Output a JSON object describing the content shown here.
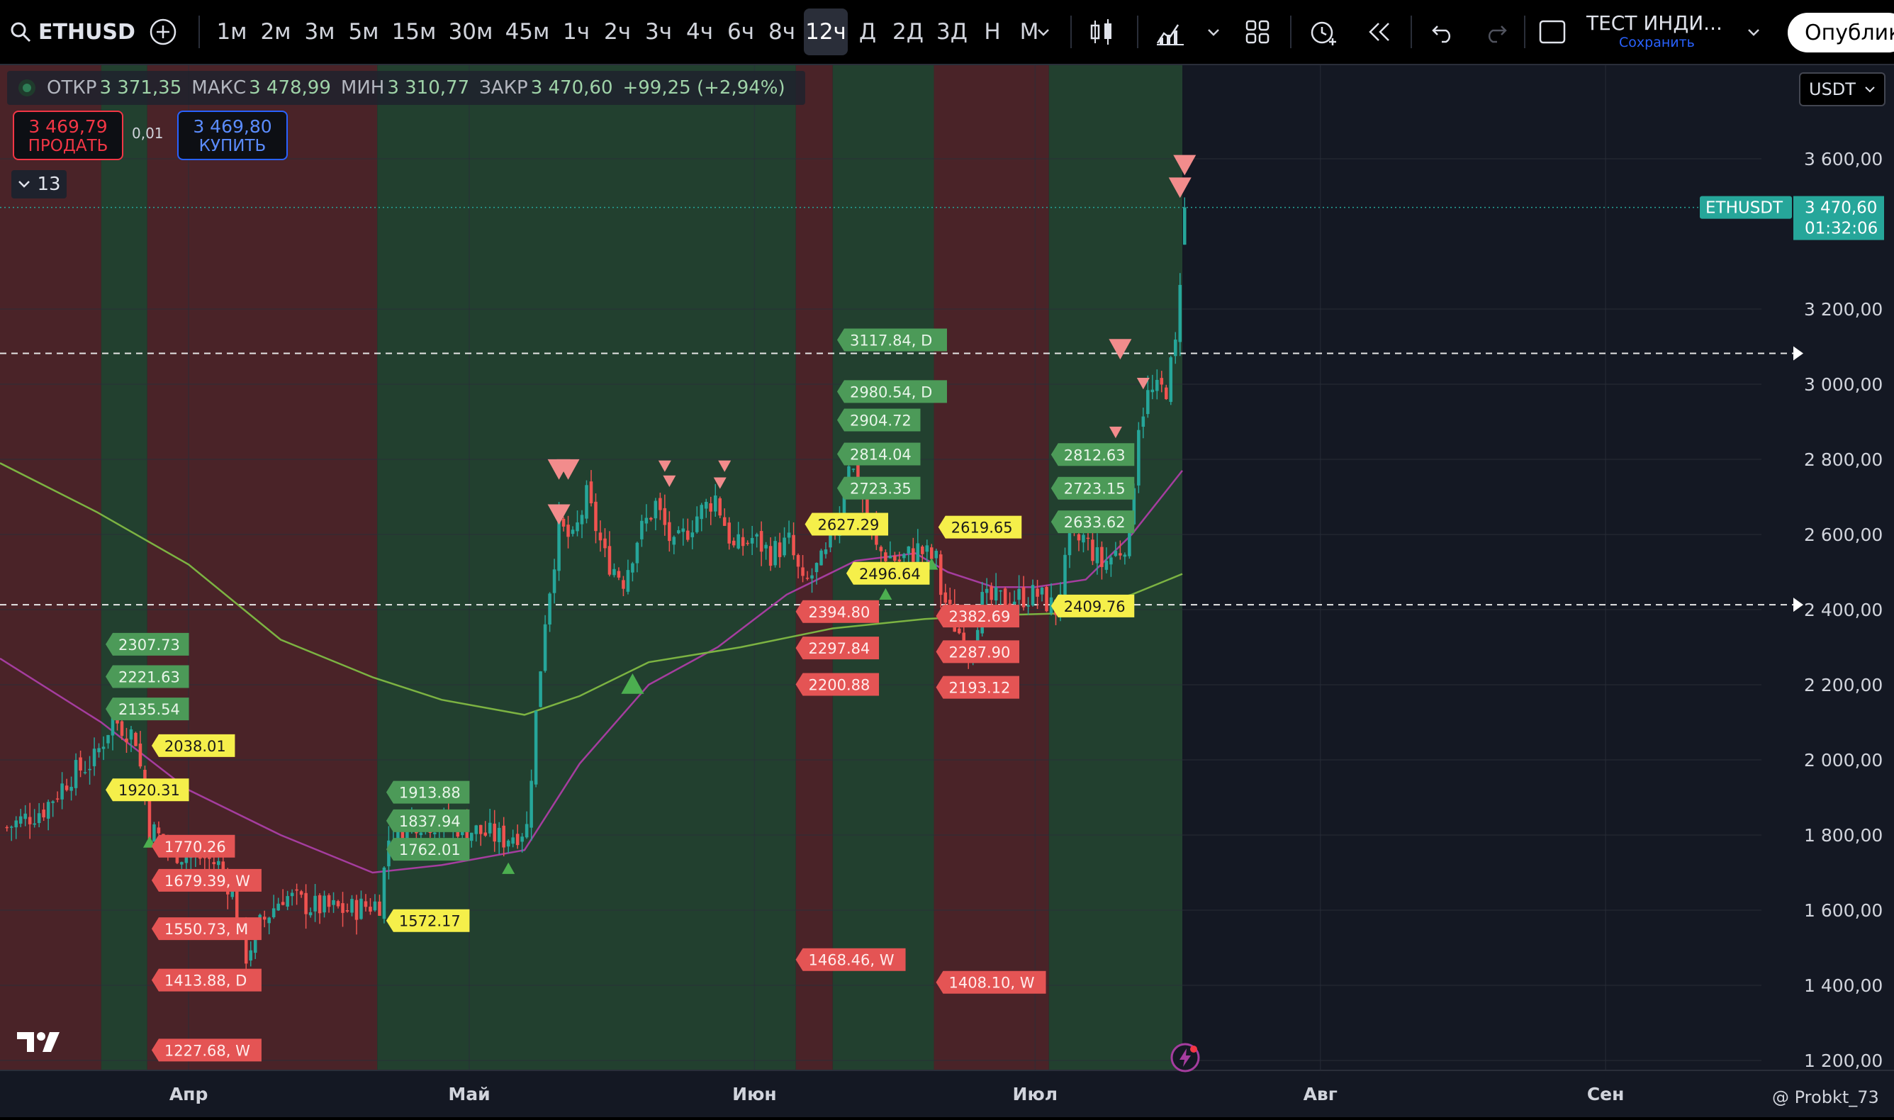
{
  "toolbar": {
    "symbol": "ETHUSD",
    "timeframes": [
      "1м",
      "2м",
      "3м",
      "5м",
      "15м",
      "30м",
      "45м",
      "1ч",
      "2ч",
      "3ч",
      "4ч",
      "6ч",
      "8ч",
      "12ч",
      "Д",
      "2Д",
      "3Д",
      "Н",
      "М"
    ],
    "active_timeframe": "12ч",
    "indicator_title": "ТЕСТ ИНДИ...",
    "save_label": "Сохранить",
    "publish_label": "Опублико"
  },
  "legend": {
    "open_label": "ОТКР",
    "open": "3 371,35",
    "high_label": "МАКС",
    "high": "3 478,99",
    "low_label": "МИН",
    "low": "3 310,77",
    "close_label": "ЗАКР",
    "close": "3 470,60",
    "change": "+99,25 (+2,94%)"
  },
  "trade": {
    "sell_price": "3 469,79",
    "sell_label": "ПРОДАТЬ",
    "spread": "0,01",
    "buy_price": "3 469,80",
    "buy_label": "КУПИТЬ",
    "counter": "13"
  },
  "currency": "USDT",
  "price_tag": {
    "symbol": "ETHUSDT",
    "price": "3 470,60",
    "countdown": "01:32:06"
  },
  "watermark": "@ Probkt_73",
  "colors": {
    "up": "#26a69a",
    "down": "#ef5350",
    "zone_red": "#4a2328",
    "zone_green": "#22402f",
    "sma_short": "#a53d9f",
    "sma_long": "#7cb342",
    "label_green": "#4c9a58",
    "label_red": "#e45454",
    "label_yellow": "#f5ef4a"
  },
  "chart_data": {
    "type": "candlestick",
    "ylim": [
      1150,
      3800
    ],
    "y_ticks": [
      {
        "v": 3600,
        "t": "3 600,00"
      },
      {
        "v": 3200,
        "t": "3 200,00"
      },
      {
        "v": 3000,
        "t": "3 000,00"
      },
      {
        "v": 2800,
        "t": "2 800,00"
      },
      {
        "v": 2600,
        "t": "2 600,00"
      },
      {
        "v": 2400,
        "t": "2 400,00"
      },
      {
        "v": 2200,
        "t": "2 200,00"
      },
      {
        "v": 2000,
        "t": "2 000,00"
      },
      {
        "v": 1800,
        "t": "1 800,00"
      },
      {
        "v": 1600,
        "t": "1 600,00"
      },
      {
        "v": 1400,
        "t": "1 400,00"
      },
      {
        "v": 1200,
        "t": "1 200,00"
      }
    ],
    "x_ticks": [
      {
        "label": "Апр",
        "i": 40
      },
      {
        "label": "Май",
        "i": 101
      },
      {
        "label": "Июн",
        "i": 163
      },
      {
        "label": "Июл",
        "i": 224
      },
      {
        "label": "Авг",
        "i": 286
      },
      {
        "label": "Сен",
        "i": 348
      }
    ],
    "x_index_range": [
      -1,
      398
    ],
    "zones": [
      {
        "from": -1,
        "to": 21,
        "kind": "red"
      },
      {
        "from": 21,
        "to": 31,
        "kind": "green"
      },
      {
        "from": 31,
        "to": 81,
        "kind": "red"
      },
      {
        "from": 81,
        "to": 172,
        "kind": "green"
      },
      {
        "from": 172,
        "to": 180,
        "kind": "red"
      },
      {
        "from": 180,
        "to": 202,
        "kind": "green"
      },
      {
        "from": 202,
        "to": 227,
        "kind": "red"
      },
      {
        "from": 227,
        "to": 256,
        "kind": "green"
      }
    ],
    "dashed_levels": [
      3082,
      2413
    ],
    "last_price": 3470.6,
    "anchors": [
      [
        0,
        1820
      ],
      [
        8,
        1870
      ],
      [
        14,
        1960
      ],
      [
        19,
        2000
      ],
      [
        23,
        2110
      ],
      [
        28,
        2060
      ],
      [
        31,
        1820
      ],
      [
        36,
        1760
      ],
      [
        40,
        1740
      ],
      [
        43,
        1740
      ],
      [
        46,
        1720
      ],
      [
        49,
        1650
      ],
      [
        52,
        1480
      ],
      [
        55,
        1560
      ],
      [
        60,
        1640
      ],
      [
        66,
        1610
      ],
      [
        74,
        1600
      ],
      [
        81,
        1620
      ],
      [
        83,
        1790
      ],
      [
        88,
        1840
      ],
      [
        96,
        1830
      ],
      [
        102,
        1810
      ],
      [
        108,
        1790
      ],
      [
        113,
        1820
      ],
      [
        115,
        2120
      ],
      [
        117,
        2380
      ],
      [
        120,
        2620
      ],
      [
        123,
        2580
      ],
      [
        126,
        2700
      ],
      [
        130,
        2540
      ],
      [
        134,
        2480
      ],
      [
        137,
        2590
      ],
      [
        141,
        2680
      ],
      [
        145,
        2560
      ],
      [
        150,
        2650
      ],
      [
        154,
        2700
      ],
      [
        158,
        2560
      ],
      [
        162,
        2590
      ],
      [
        166,
        2550
      ],
      [
        170,
        2580
      ],
      [
        173,
        2460
      ],
      [
        178,
        2540
      ],
      [
        181,
        2660
      ],
      [
        183,
        2800
      ],
      [
        186,
        2700
      ],
      [
        189,
        2560
      ],
      [
        194,
        2530
      ],
      [
        198,
        2560
      ],
      [
        202,
        2530
      ],
      [
        203,
        2450
      ],
      [
        206,
        2360
      ],
      [
        209,
        2300
      ],
      [
        212,
        2420
      ],
      [
        218,
        2430
      ],
      [
        224,
        2440
      ],
      [
        228,
        2400
      ],
      [
        231,
        2570
      ],
      [
        234,
        2590
      ],
      [
        238,
        2520
      ],
      [
        242,
        2560
      ],
      [
        244,
        2600
      ],
      [
        246,
        2900
      ],
      [
        248,
        2970
      ],
      [
        252,
        2990
      ],
      [
        254,
        3100
      ],
      [
        255,
        3290
      ],
      [
        256,
        3470
      ]
    ],
    "sma_short": [
      [
        -1,
        2270
      ],
      [
        21,
        2100
      ],
      [
        40,
        1920
      ],
      [
        60,
        1800
      ],
      [
        80,
        1700
      ],
      [
        95,
        1720
      ],
      [
        113,
        1760
      ],
      [
        125,
        1990
      ],
      [
        140,
        2200
      ],
      [
        155,
        2300
      ],
      [
        170,
        2440
      ],
      [
        185,
        2530
      ],
      [
        198,
        2550
      ],
      [
        205,
        2500
      ],
      [
        215,
        2460
      ],
      [
        224,
        2460
      ],
      [
        235,
        2480
      ],
      [
        245,
        2600
      ],
      [
        256,
        2770
      ]
    ],
    "sma_long": [
      [
        -1,
        2790
      ],
      [
        20,
        2660
      ],
      [
        40,
        2520
      ],
      [
        60,
        2320
      ],
      [
        80,
        2220
      ],
      [
        95,
        2160
      ],
      [
        113,
        2120
      ],
      [
        125,
        2170
      ],
      [
        140,
        2260
      ],
      [
        160,
        2300
      ],
      [
        180,
        2350
      ],
      [
        200,
        2375
      ],
      [
        215,
        2385
      ],
      [
        230,
        2390
      ],
      [
        245,
        2440
      ],
      [
        256,
        2495
      ]
    ],
    "value_labels": [
      {
        "i": 23.5,
        "v": 2307.73,
        "t": "2307.73",
        "c": "green"
      },
      {
        "i": 23.5,
        "v": 2221.63,
        "t": "2221.63",
        "c": "green"
      },
      {
        "i": 23.5,
        "v": 2135.54,
        "t": "2135.54",
        "c": "green"
      },
      {
        "i": 33.5,
        "v": 2038.01,
        "t": "2038.01",
        "c": "yellow"
      },
      {
        "i": 23.5,
        "v": 1920.31,
        "t": "1920.31",
        "c": "yellow"
      },
      {
        "i": 33.5,
        "v": 1770.26,
        "t": "1770.26",
        "c": "red"
      },
      {
        "i": 33.5,
        "v": 1679.39,
        "t": "1679.39, W",
        "c": "red"
      },
      {
        "i": 33.5,
        "v": 1550.73,
        "t": "1550.73, M",
        "c": "red"
      },
      {
        "i": 33.5,
        "v": 1413.88,
        "t": "1413.88, D",
        "c": "red"
      },
      {
        "i": 33.5,
        "v": 1227.68,
        "t": "1227.68, W",
        "c": "red"
      },
      {
        "i": 84.5,
        "v": 1913.88,
        "t": "1913.88",
        "c": "green"
      },
      {
        "i": 84.5,
        "v": 1837.94,
        "t": "1837.94",
        "c": "green"
      },
      {
        "i": 84.5,
        "v": 1762.01,
        "t": "1762.01",
        "c": "green"
      },
      {
        "i": 84.5,
        "v": 1572.17,
        "t": "1572.17",
        "c": "yellow"
      },
      {
        "i": 182.5,
        "v": 3117.84,
        "t": "3117.84, D",
        "c": "green"
      },
      {
        "i": 182.5,
        "v": 2980.54,
        "t": "2980.54, D",
        "c": "green"
      },
      {
        "i": 182.5,
        "v": 2904.72,
        "t": "2904.72",
        "c": "green"
      },
      {
        "i": 182.5,
        "v": 2814.04,
        "t": "2814.04",
        "c": "green"
      },
      {
        "i": 182.5,
        "v": 2723.35,
        "t": "2723.35",
        "c": "green"
      },
      {
        "i": 175.5,
        "v": 2627.29,
        "t": "2627.29",
        "c": "yellow"
      },
      {
        "i": 184.5,
        "v": 2496.64,
        "t": "2496.64",
        "c": "yellow"
      },
      {
        "i": 173.5,
        "v": 2394.8,
        "t": "2394.80",
        "c": "red"
      },
      {
        "i": 173.5,
        "v": 2297.84,
        "t": "2297.84",
        "c": "red"
      },
      {
        "i": 173.5,
        "v": 2200.88,
        "t": "2200.88",
        "c": "red"
      },
      {
        "i": 173.5,
        "v": 1468.46,
        "t": "1468.46, W",
        "c": "red"
      },
      {
        "i": 204.5,
        "v": 2619.65,
        "t": "2619.65",
        "c": "yellow"
      },
      {
        "i": 204,
        "v": 2382.69,
        "t": "2382.69",
        "c": "red"
      },
      {
        "i": 204,
        "v": 2287.9,
        "t": "2287.90",
        "c": "red"
      },
      {
        "i": 204,
        "v": 2193.12,
        "t": "2193.12",
        "c": "red"
      },
      {
        "i": 204,
        "v": 1408.1,
        "t": "1408.10, W",
        "c": "red"
      },
      {
        "i": 229,
        "v": 2812.63,
        "t": "2812.63",
        "c": "green"
      },
      {
        "i": 229,
        "v": 2723.15,
        "t": "2723.15",
        "c": "green"
      },
      {
        "i": 229,
        "v": 2633.62,
        "t": "2633.62",
        "c": "green"
      },
      {
        "i": 229,
        "v": 2409.76,
        "t": "2409.76",
        "c": "yellow"
      }
    ],
    "markers": [
      {
        "i": 120,
        "v": 2770,
        "d": "down",
        "s": "big"
      },
      {
        "i": 122,
        "v": 2770,
        "d": "down",
        "s": "big"
      },
      {
        "i": 120,
        "v": 2650,
        "d": "down",
        "s": "big"
      },
      {
        "i": 143,
        "v": 2780,
        "d": "down",
        "s": "small"
      },
      {
        "i": 144,
        "v": 2740,
        "d": "down",
        "s": "small"
      },
      {
        "i": 155,
        "v": 2735,
        "d": "down",
        "s": "small"
      },
      {
        "i": 156,
        "v": 2780,
        "d": "down",
        "s": "small"
      },
      {
        "i": 242,
        "v": 3090,
        "d": "down",
        "s": "big"
      },
      {
        "i": 247,
        "v": 3000,
        "d": "down",
        "s": "small"
      },
      {
        "i": 241,
        "v": 2870,
        "d": "down",
        "s": "small"
      },
      {
        "i": 256,
        "v": 3580,
        "d": "down",
        "s": "big"
      },
      {
        "i": 255,
        "v": 3520,
        "d": "down",
        "s": "big"
      },
      {
        "i": 136,
        "v": 2200,
        "d": "up",
        "s": "big"
      },
      {
        "i": 109,
        "v": 1710,
        "d": "up",
        "s": "small"
      },
      {
        "i": 31,
        "v": 1780,
        "d": "up",
        "s": "small"
      },
      {
        "i": 191,
        "v": 2440,
        "d": "up",
        "s": "small"
      },
      {
        "i": 201,
        "v": 2520,
        "d": "up",
        "s": "small"
      }
    ]
  }
}
